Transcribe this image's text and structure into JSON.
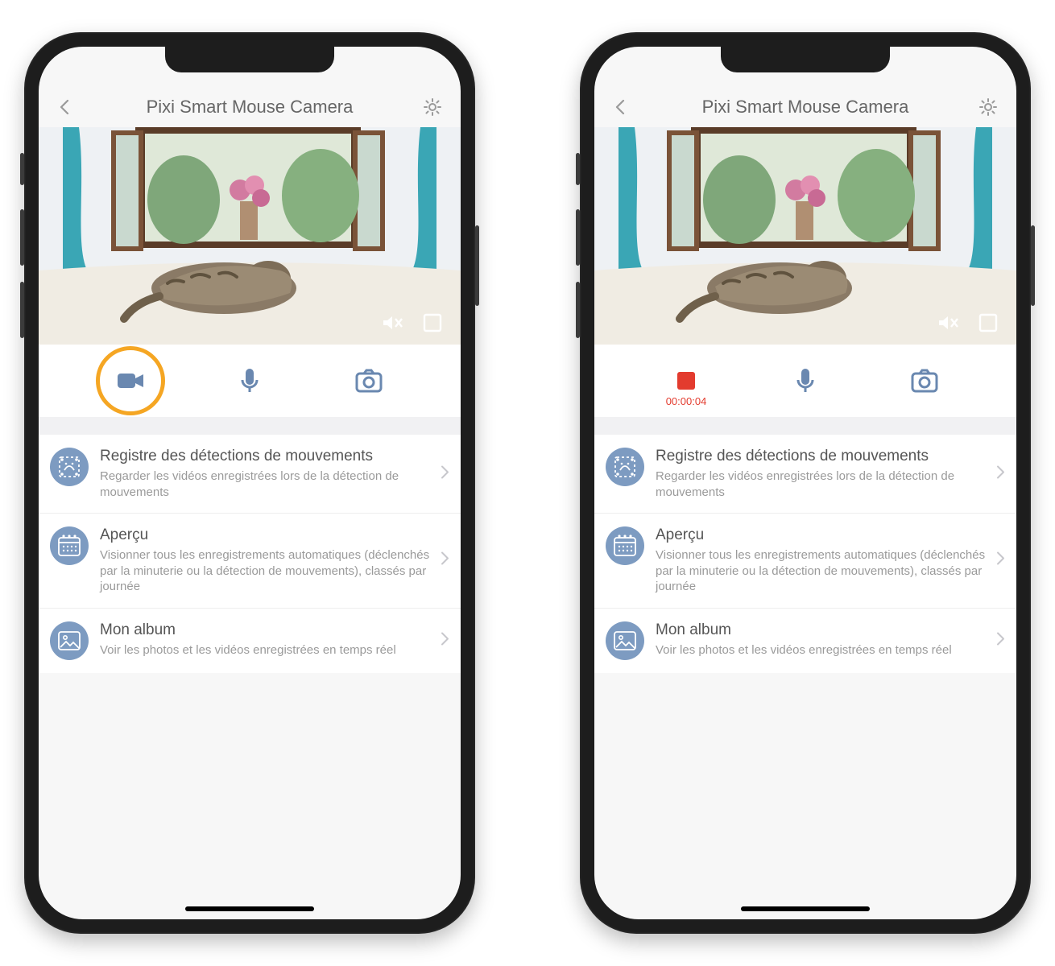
{
  "phones": [
    {
      "header": {
        "title": "Pixi Smart Mouse Camera"
      },
      "actions": {
        "record": {
          "state": "idle",
          "highlighted": true
        },
        "timerText": ""
      },
      "menu": [
        {
          "icon": "motion",
          "title": "Registre des détections de mouvements",
          "subtitle": "Regarder les vidéos enregistrées lors de la détection de mouvements"
        },
        {
          "icon": "calendar",
          "title": "Aperçu",
          "subtitle": "Visionner tous les enregistrements automatiques (déclenchés par la minuterie ou la détection de mouvements), classés par journée"
        },
        {
          "icon": "album",
          "title": "Mon album",
          "subtitle": "Voir les photos et les vidéos enregistrées en temps réel"
        }
      ]
    },
    {
      "header": {
        "title": "Pixi Smart Mouse Camera"
      },
      "actions": {
        "record": {
          "state": "recording",
          "highlighted": false
        },
        "timerText": "00:00:04"
      },
      "menu": [
        {
          "icon": "motion",
          "title": "Registre des détections de mouvements",
          "subtitle": "Regarder les vidéos enregistrées lors de la détection de mouvements"
        },
        {
          "icon": "calendar",
          "title": "Aperçu",
          "subtitle": "Visionner tous les enregistrements automatiques (déclenchés par la minuterie ou la détection de mouvements), classés par journée"
        },
        {
          "icon": "album",
          "title": "Mon album",
          "subtitle": "Voir les photos et les vidéos enregistrées en temps réel"
        }
      ]
    }
  ]
}
